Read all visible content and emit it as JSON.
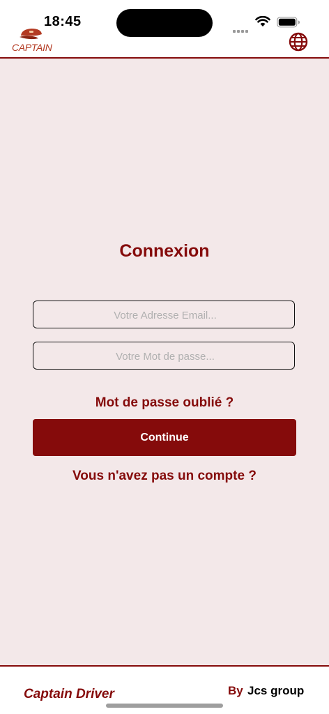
{
  "status_bar": {
    "time": "18:45",
    "icons": [
      "signal-dots-icon",
      "wifi-icon",
      "battery-icon"
    ]
  },
  "header": {
    "logo_text": "CAPTAIN",
    "language_icon": "globe-icon"
  },
  "login": {
    "title": "Connexion",
    "email_placeholder": "Votre Adresse Email...",
    "email_value": "",
    "password_placeholder": "Votre Mot de passe...",
    "password_value": "",
    "forgot_password": "Mot de passe oublié ?",
    "continue_label": "Continue",
    "no_account": "Vous n'avez pas un compte ?"
  },
  "footer": {
    "app_name": "Captain Driver",
    "by_label": "By",
    "company": "Jcs group"
  },
  "colors": {
    "brand": "#850b0b",
    "background": "#f3e8e9",
    "logo": "#b33a22"
  }
}
